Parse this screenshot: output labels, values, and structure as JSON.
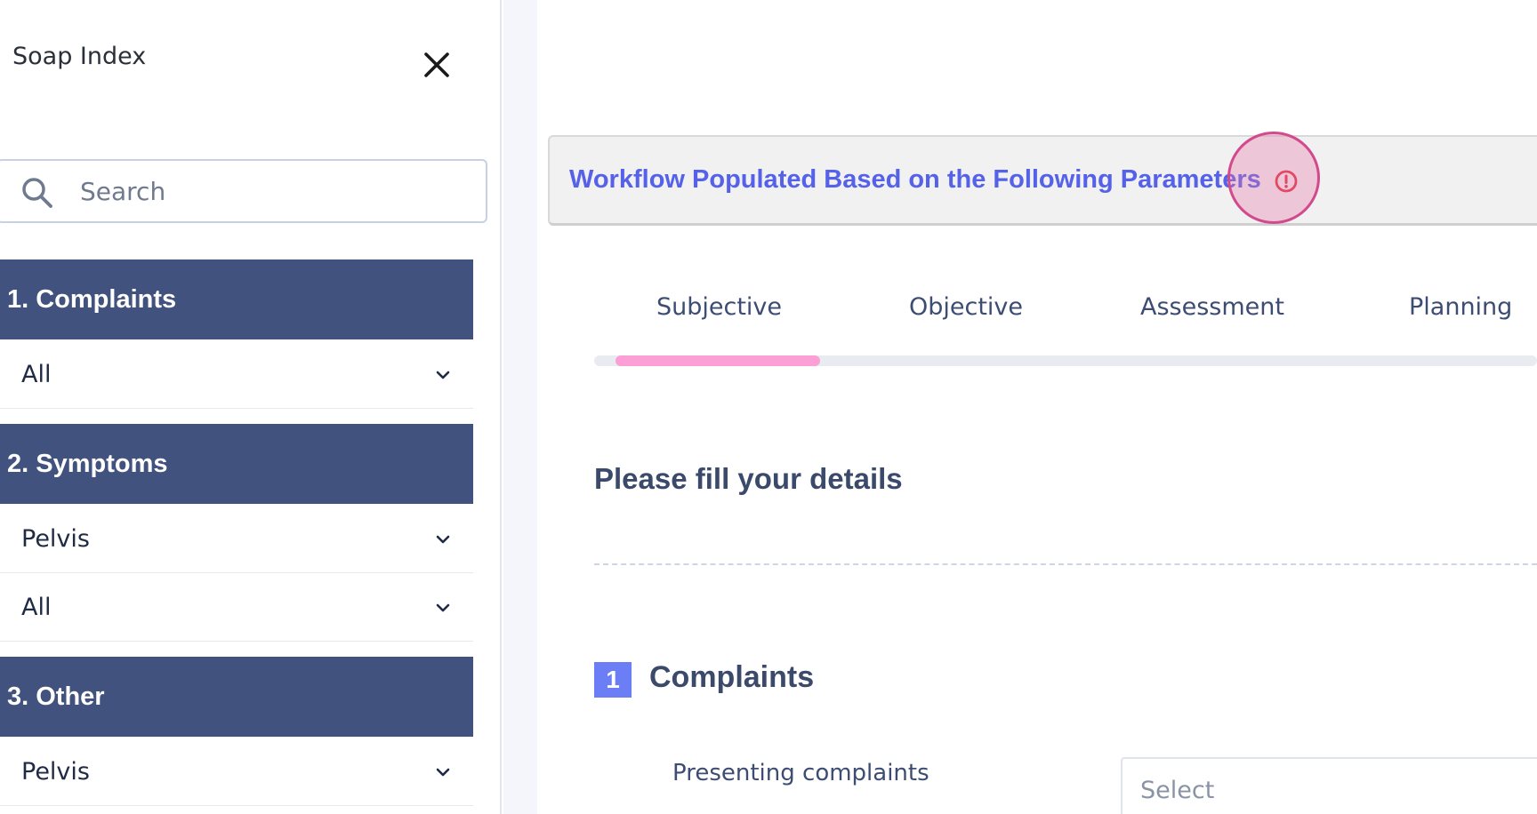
{
  "sidebar": {
    "title": "Soap Index",
    "search": {
      "placeholder": "Search",
      "value": ""
    },
    "sections": [
      {
        "label": "1. Complaints",
        "rows": [
          "All"
        ]
      },
      {
        "label": "2. Symptoms",
        "rows": [
          "Pelvis",
          "All"
        ]
      },
      {
        "label": "3. Other",
        "rows": [
          "Pelvis"
        ]
      }
    ]
  },
  "banner": {
    "text": "Workflow Populated Based on the Following Parameters",
    "icon": "alert-circle-icon",
    "text_color": "#5561e8",
    "icon_color": "#e0313f"
  },
  "tabs": [
    {
      "label": "Subjective",
      "active": true
    },
    {
      "label": "Objective",
      "active": false
    },
    {
      "label": "Assessment",
      "active": false
    },
    {
      "label": "Planning",
      "active": false
    }
  ],
  "form": {
    "heading": "Please fill your details",
    "section_number": "1",
    "section_title": "Complaints",
    "fields": [
      {
        "label": "Presenting complaints",
        "placeholder": "Select"
      }
    ]
  },
  "colors": {
    "section_header_bg": "#40527d",
    "active_tab_indicator": "#fb9fd6",
    "badge": "#6c7ef5"
  }
}
